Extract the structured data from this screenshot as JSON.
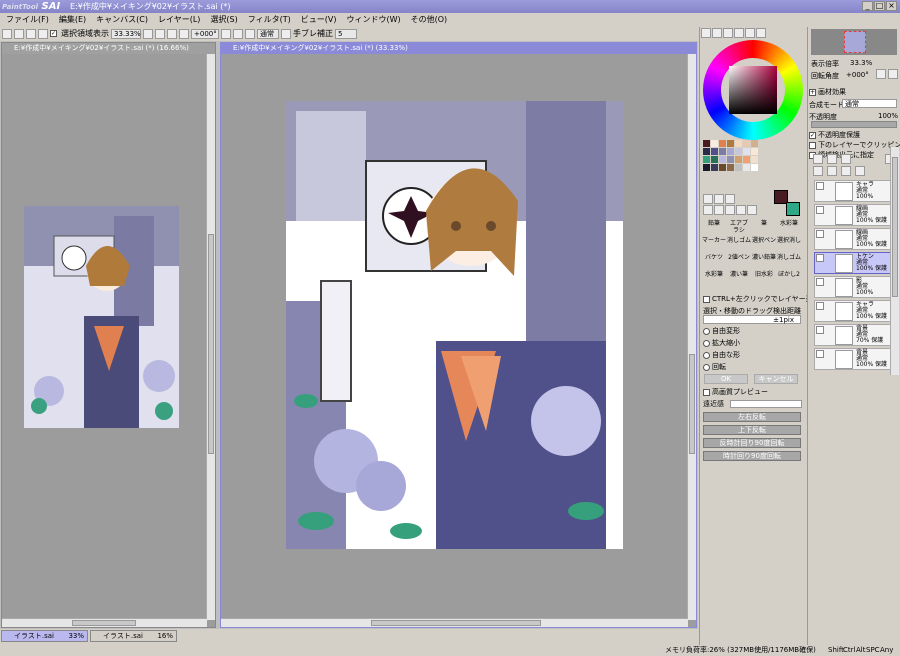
{
  "app": {
    "logo_small": "PaintTool",
    "logo_big": "SAI",
    "title": "E:¥作成中¥メイキング¥02¥イラスト.sai (*)"
  },
  "menu": [
    "ファイル(F)",
    "編集(E)",
    "キャンバス(C)",
    "レイヤー(L)",
    "選択(S)",
    "フィルタ(T)",
    "ビュー(V)",
    "ウィンドウ(W)",
    "その他(O)"
  ],
  "toolbar": {
    "selection_label": "選択領域表示",
    "zoom": "33.33%",
    "angle": "+000°",
    "blend": "通常",
    "stabilizer_label": "手ブレ補正",
    "stabilizer": "5"
  },
  "views": {
    "left_title": "E:¥作成中¥メイキング¥02¥イラスト.sai (*) (16.66%)",
    "right_title": "E:¥作成中¥メイキング¥02¥イラスト.sai (*) (33.33%)"
  },
  "tabs": [
    {
      "name": "イラスト.sai",
      "pct": "33%"
    },
    {
      "name": "イラスト.sai",
      "pct": "16%"
    }
  ],
  "status": {
    "memory": "メモリ負荷率:26% (327MB使用/1176MB確保)",
    "keys": [
      "Shift",
      "Ctrl",
      "Alt",
      "SPC",
      "Any"
    ]
  },
  "colors": {
    "title": "#8484c8",
    "current": "#4a1a22",
    "sub": "#2fa888",
    "accent": "#6464c8"
  },
  "mid": {
    "tool_labels": [
      "鉛筆",
      "エアブラシ",
      "筆",
      "水彩筆",
      "マーカー",
      "消しゴム",
      "選択ペン",
      "選択消し",
      "バケツ",
      "2値ペン",
      "濃い鉛筆",
      "消しゴム",
      "水彩筆",
      "濃い筆",
      "旧水彩",
      "ぼかし2"
    ],
    "ctrl_label": "CTRL+左クリックでレイヤー選択",
    "drag_label": "選択・移動のドラッグ検出距離",
    "drag_value": "±1pix",
    "transform_options": [
      "自由変形",
      "拡大縮小",
      "自由な形",
      "回転"
    ],
    "ok_label": "OK",
    "cancel_label": "キャンセル",
    "preview_label": "高画質プレビュー",
    "perspective_label": "遠近感",
    "buttons": [
      "左右反転",
      "上下反転",
      "反時計回り90度回転",
      "時計回り90度回転"
    ]
  },
  "right": {
    "zoom_label": "表示倍率",
    "zoom": "33.3%",
    "angle_label": "回転角度",
    "angle": "+000°",
    "paper_label": "画材効果",
    "blend_label": "合成モード",
    "blend": "通常",
    "opacity_label": "不透明度",
    "opacity": "100%",
    "checks": [
      "不透明度保護",
      "下のレイヤーでクリッピング",
      "領域検出元に指定"
    ],
    "layers": [
      {
        "name": "キャラ",
        "mode": "通常",
        "op": "100%"
      },
      {
        "name": "線画",
        "mode": "通常",
        "op": "100% 保護"
      },
      {
        "name": "線画",
        "mode": "通常",
        "op": "100% 保護"
      },
      {
        "name": "トケン",
        "mode": "通常",
        "op": "100% 保護"
      },
      {
        "name": "影",
        "mode": "通常",
        "op": "100%"
      },
      {
        "name": "キャラ",
        "mode": "通常",
        "op": "100% 保護"
      },
      {
        "name": "背景",
        "mode": "通常",
        "op": "70% 保護"
      },
      {
        "name": "背景",
        "mode": "通常",
        "op": "100% 保護"
      }
    ]
  }
}
